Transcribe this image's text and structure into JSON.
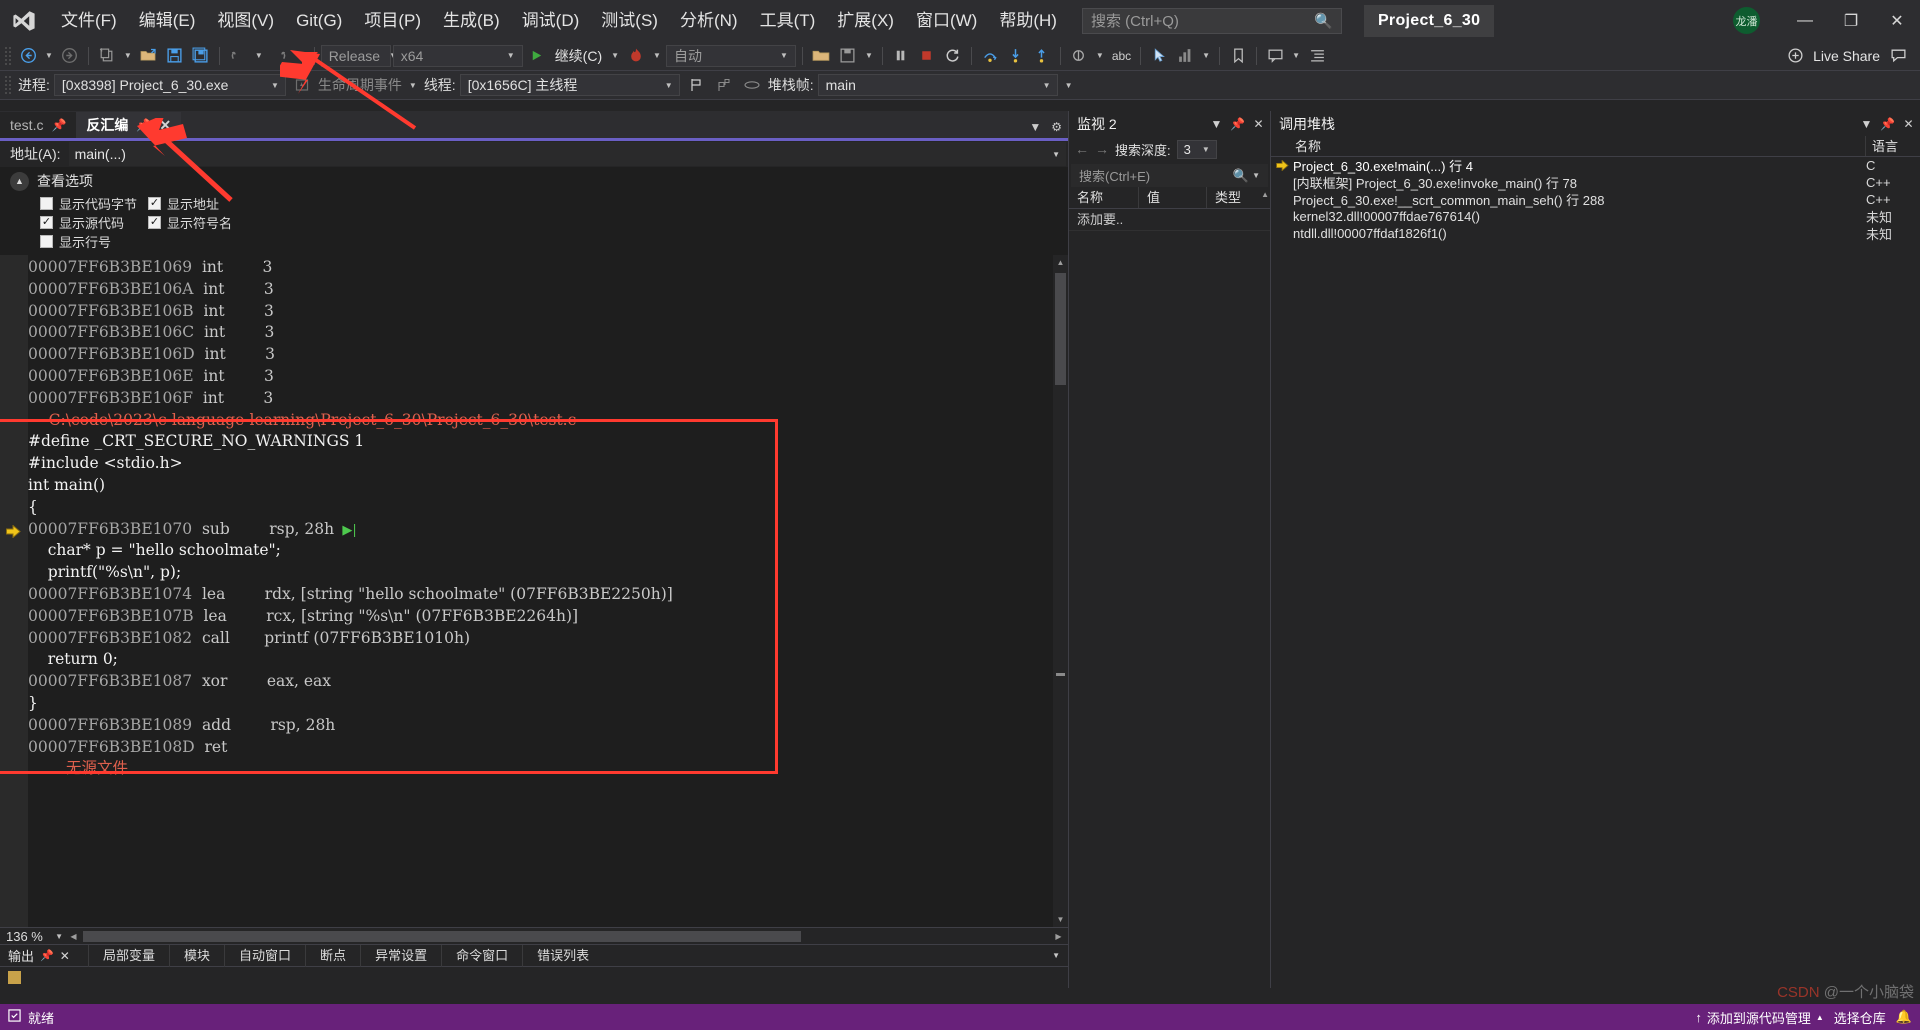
{
  "titlebar": {
    "logo_icon": "visual-studio-logo",
    "menus": [
      {
        "label": "文件(F)"
      },
      {
        "label": "编辑(E)"
      },
      {
        "label": "视图(V)"
      },
      {
        "label": "Git(G)"
      },
      {
        "label": "项目(P)"
      },
      {
        "label": "生成(B)"
      },
      {
        "label": "调试(D)"
      },
      {
        "label": "测试(S)"
      },
      {
        "label": "分析(N)"
      },
      {
        "label": "工具(T)"
      },
      {
        "label": "扩展(X)"
      },
      {
        "label": "窗口(W)"
      },
      {
        "label": "帮助(H)"
      }
    ],
    "search_placeholder": "搜索 (Ctrl+Q)",
    "project_tab": "Project_6_30",
    "avatar_text": "龙潘",
    "minimize": "—",
    "restore": "❐",
    "close": "✕"
  },
  "toolbar": {
    "back_icon": "navigate-back-icon",
    "forward_icon": "navigate-forward-icon",
    "new_item_icon": "new-item-icon",
    "open_icon": "open-file-icon",
    "save_icon": "save-icon",
    "save_all_icon": "save-all-icon",
    "undo_icon": "undo-icon",
    "redo_icon": "redo-icon",
    "config_value": "Release",
    "platform_value": "x64",
    "continue_label": "继续(C)",
    "hotreload_icon": "hot-reload-icon",
    "auto_value": "自动",
    "live_share": "Live Share",
    "abc_icon": "abc-icon"
  },
  "debugbar": {
    "process_label": "进程:",
    "process_value": "[0x8398] Project_6_30.exe",
    "lifecycle_label": "生命周期事件",
    "thread_label": "线程:",
    "thread_value": "[0x1656C] 主线程",
    "stackframe_label": "堆栈帧:",
    "stackframe_value": "main"
  },
  "document": {
    "tabs": [
      {
        "label": "test.c",
        "active": false,
        "pin_icon": "pin-icon"
      },
      {
        "label": "反汇编",
        "active": true,
        "pin_icon": "pin-icon",
        "close_icon": "close-icon"
      }
    ],
    "address_label": "地址(A):",
    "address_value": "main(...)",
    "view_options_title": "查看选项",
    "view_options": [
      {
        "label": "显示代码字节",
        "checked": false
      },
      {
        "label": "显示地址",
        "checked": true
      },
      {
        "label": "显示源代码",
        "checked": true
      },
      {
        "label": "显示符号名",
        "checked": true
      },
      {
        "label": "显示行号",
        "checked": false
      }
    ],
    "zoom_level": "136 %",
    "source_path_line": "--- C:\\code\\2023\\c-language-learning\\Project_6_30\\Project_6_30\\test.c ----------",
    "no_source_text": "无源文件",
    "lines": [
      {
        "kind": "asm",
        "addr": "00007FF6B3BE1069",
        "op": "int",
        "args": "3"
      },
      {
        "kind": "asm",
        "addr": "00007FF6B3BE106A",
        "op": "int",
        "args": "3"
      },
      {
        "kind": "asm",
        "addr": "00007FF6B3BE106B",
        "op": "int",
        "args": "3"
      },
      {
        "kind": "asm",
        "addr": "00007FF6B3BE106C",
        "op": "int",
        "args": "3"
      },
      {
        "kind": "asm",
        "addr": "00007FF6B3BE106D",
        "op": "int",
        "args": "3"
      },
      {
        "kind": "asm",
        "addr": "00007FF6B3BE106E",
        "op": "int",
        "args": "3"
      },
      {
        "kind": "asm",
        "addr": "00007FF6B3BE106F",
        "op": "int",
        "args": "3"
      },
      {
        "kind": "path",
        "text": "--- C:\\code\\2023\\c-language-learning\\Project_6_30\\Project_6_30\\test.c ----------"
      },
      {
        "kind": "src",
        "text": "#define _CRT_SECURE_NO_WARNINGS 1"
      },
      {
        "kind": "src",
        "text": "#include <stdio.h>"
      },
      {
        "kind": "src",
        "text": "int main()"
      },
      {
        "kind": "src",
        "text": "{"
      },
      {
        "kind": "asm",
        "addr": "00007FF6B3BE1070",
        "op": "sub",
        "args": "rsp, 28h",
        "current": true,
        "green_arrow": true
      },
      {
        "kind": "src",
        "text": "    char* p = \"hello schoolmate\";"
      },
      {
        "kind": "src",
        "text": "    printf(\"%s\\n\", p);"
      },
      {
        "kind": "asm",
        "addr": "00007FF6B3BE1074",
        "op": "lea",
        "args": "rdx, [string \"hello schoolmate\" (07FF6B3BE2250h)]"
      },
      {
        "kind": "asm",
        "addr": "00007FF6B3BE107B",
        "op": "lea",
        "args": "rcx, [string \"%s\\n\" (07FF6B3BE2264h)]"
      },
      {
        "kind": "asm",
        "addr": "00007FF6B3BE1082",
        "op": "call",
        "args": "printf (07FF6B3BE1010h)"
      },
      {
        "kind": "src",
        "text": "    return 0;"
      },
      {
        "kind": "asm",
        "addr": "00007FF6B3BE1087",
        "op": "xor",
        "args": "eax, eax"
      },
      {
        "kind": "src",
        "text": "}"
      },
      {
        "kind": "asm",
        "addr": "00007FF6B3BE1089",
        "op": "add",
        "args": "rsp, 28h"
      },
      {
        "kind": "asm",
        "addr": "00007FF6B3BE108D",
        "op": "ret",
        "args": ""
      },
      {
        "kind": "nosrc",
        "text": "无源文件"
      }
    ],
    "bottom_tabs": [
      {
        "label": "输出",
        "active": true,
        "pin_icon": "pin-icon",
        "close_icon": "close-icon"
      },
      {
        "label": "局部变量"
      },
      {
        "label": "模块"
      },
      {
        "label": "自动窗口"
      },
      {
        "label": "断点"
      },
      {
        "label": "异常设置"
      },
      {
        "label": "命令窗口"
      },
      {
        "label": "错误列表"
      }
    ]
  },
  "watch_pane": {
    "title": "监视 2",
    "caret_icon": "chevron-down-icon",
    "pin_icon": "pin-icon",
    "close_icon": "close-icon",
    "back_icon": "arrow-left-icon",
    "forward_icon": "arrow-right-icon",
    "depth_label": "搜索深度:",
    "depth_value": "3",
    "search_placeholder": "搜索(Ctrl+E)",
    "search_icon": "search-icon",
    "columns": [
      "名称",
      "值",
      "类型"
    ],
    "add_row_label": "添加要.."
  },
  "callstack": {
    "title": "调用堆栈",
    "caret_icon": "chevron-down-icon",
    "pin_icon": "pin-icon",
    "close_icon": "close-icon",
    "columns": {
      "name": "名称",
      "lang": "语言"
    },
    "rows": [
      {
        "name": "Project_6_30.exe!main(...) 行 4",
        "lang": "C",
        "current": true
      },
      {
        "name": "[内联框架] Project_6_30.exe!invoke_main() 行 78",
        "lang": "C++"
      },
      {
        "name": "Project_6_30.exe!__scrt_common_main_seh() 行 288",
        "lang": "C++"
      },
      {
        "name": "kernel32.dll!00007ffdae767614()",
        "lang": "未知"
      },
      {
        "name": "ntdll.dll!00007ffdaf1826f1()",
        "lang": "未知"
      }
    ]
  },
  "statusbar": {
    "ready": "就绪",
    "source_control": "添加到源代码管理",
    "repo": "选择仓库",
    "up_icon": "arrow-up-icon",
    "caret_icon": "chevron-up-icon",
    "bell_icon": "bell-icon"
  },
  "watermark": {
    "prefix": "CSDN",
    "text": "@一个小脑袋"
  },
  "colors": {
    "accent": "#6a5fc4",
    "status_bar": "#68217a",
    "annotation": "#ff3a2f",
    "chrome": "#2d2d30",
    "editor_bg": "#1e1e1e",
    "source_path": "#e0604d",
    "ip_arrow": "#f0c419"
  }
}
